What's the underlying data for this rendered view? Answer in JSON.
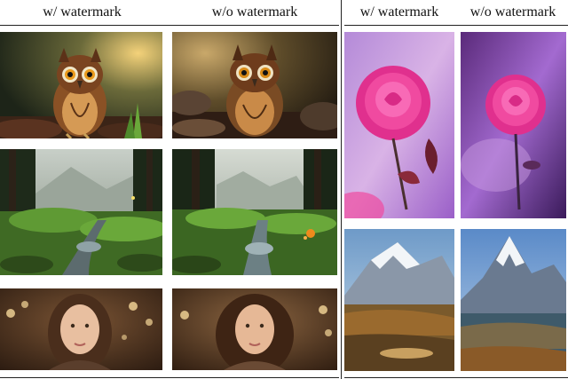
{
  "figure": {
    "left_panel": {
      "headers": [
        "w/ watermark",
        "w/o watermark"
      ],
      "rows": [
        {
          "subject": "owl",
          "icon": "owl-image"
        },
        {
          "subject": "forest",
          "icon": "forest-image"
        },
        {
          "subject": "woman",
          "icon": "portrait-image"
        }
      ]
    },
    "right_panel": {
      "headers": [
        "w/ watermark",
        "w/o watermark"
      ],
      "rows": [
        {
          "subject": "rose",
          "icon": "rose-image"
        },
        {
          "subject": "mountain",
          "icon": "mountain-image"
        }
      ]
    }
  }
}
